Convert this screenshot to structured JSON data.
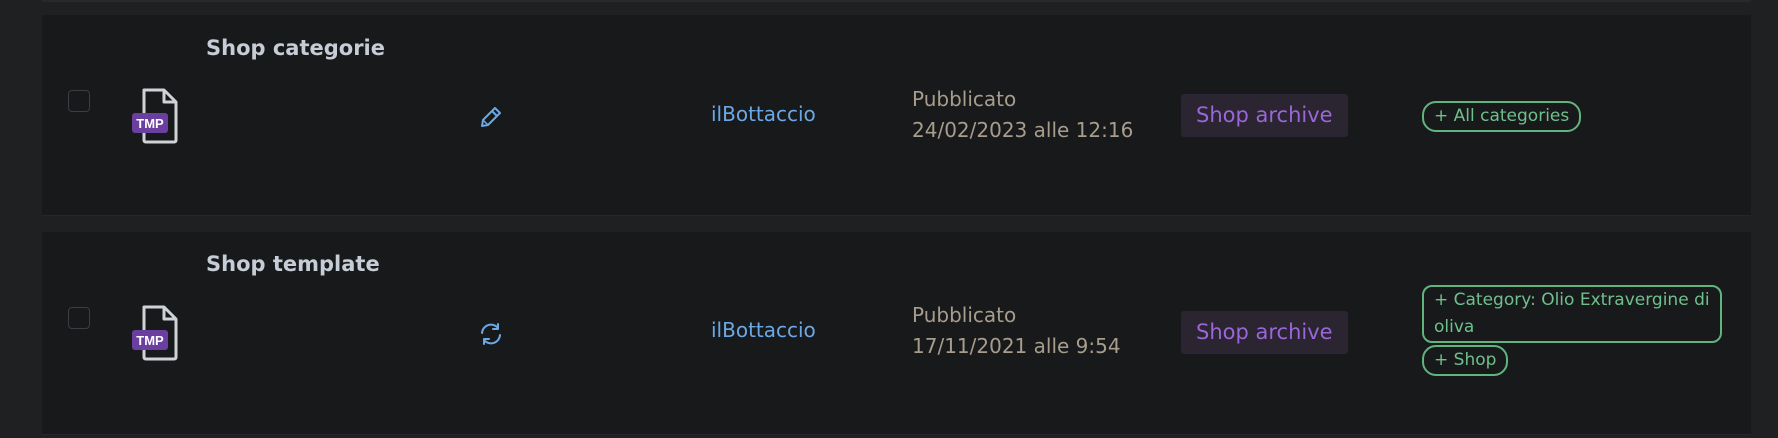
{
  "rows": [
    {
      "title": "Shop categorie",
      "file_badge": "TMP",
      "action_icon": "pencil-icon",
      "author": "ilBottaccio",
      "status": "Pubblicato",
      "date": "24/02/2023 alle 12:16",
      "type": "Shop archive",
      "conditions": [
        "+ All categories"
      ]
    },
    {
      "title": "Shop template",
      "file_badge": "TMP",
      "action_icon": "sync-icon",
      "author": "ilBottaccio",
      "status": "Pubblicato",
      "date": "17/11/2021 alle 9:54",
      "type": "Shop archive",
      "conditions": [
        "+ Category: Olio Extravergine di oliva",
        "+ Shop"
      ]
    }
  ],
  "colors": {
    "background": "#1e2022",
    "row_background": "#18191b",
    "title": "#c6cdd6",
    "author_link": "#6aa8e6",
    "status_text": "#a89d8d",
    "type_badge_text": "#9a66d8",
    "type_badge_bg": "#2a2530",
    "condition_chip": "#5fb57d",
    "file_badge": "#6b3fa0"
  }
}
